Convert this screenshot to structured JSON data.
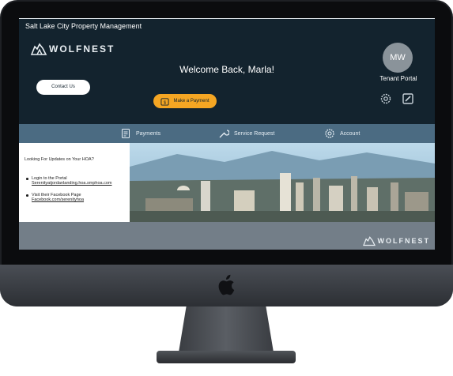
{
  "header": {
    "site_title": "Salt Lake City Property Management",
    "brand": "WOLFNEST",
    "welcome": "Welcome Back, Marla!"
  },
  "buttons": {
    "contact": "Contact Us",
    "payment": "Make a Payment"
  },
  "user": {
    "initials": "MW",
    "portal_label": "Tenant Portal"
  },
  "nav": {
    "items": [
      {
        "label": "Payments",
        "icon": "receipt-icon"
      },
      {
        "label": "Service Request",
        "icon": "wrench-icon"
      },
      {
        "label": "Account",
        "icon": "gear-icon"
      }
    ]
  },
  "hoa": {
    "question": "Looking For Updates on Your HOA?",
    "items": [
      {
        "title": "Login to the Portal",
        "link": "Serenityatjordanlanding.hoa.smphoa.com"
      },
      {
        "title": "Visit their Facebook Page",
        "link": "Facebook.com/serenityhoa"
      }
    ]
  },
  "footer": {
    "brand": "WOLFNEST"
  },
  "colors": {
    "background": "#13232e",
    "nav": "#4b6b82",
    "accent": "#f5a623",
    "footer": "#737e88"
  }
}
